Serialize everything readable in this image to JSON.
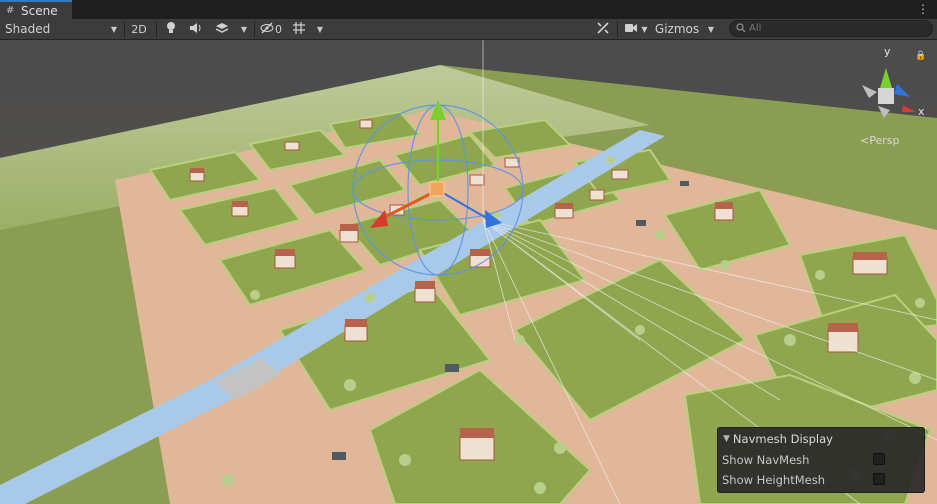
{
  "tab": {
    "title": "Scene",
    "icon": "grid-icon"
  },
  "toolbar": {
    "shading_mode": "Shaded",
    "mode_2d": "2D",
    "hidden_count": "0",
    "gizmos_label": "Gizmos",
    "search_placeholder": "All"
  },
  "orientation_gizmo": {
    "y_label": "y",
    "x_label": "x",
    "projection": "Persp"
  },
  "navmesh_panel": {
    "title": "Navmesh Display",
    "rows": [
      {
        "label": "Show NavMesh",
        "checked": false
      },
      {
        "label": "Show HeightMesh",
        "checked": false
      }
    ]
  },
  "colors": {
    "accent": "#3a79bb",
    "axis_x": "#d83b2b",
    "axis_y": "#7bd12b",
    "axis_z": "#2f74e0",
    "grass": "#8fa64f",
    "road": "#e3b89a",
    "water": "#a9c9e8"
  }
}
